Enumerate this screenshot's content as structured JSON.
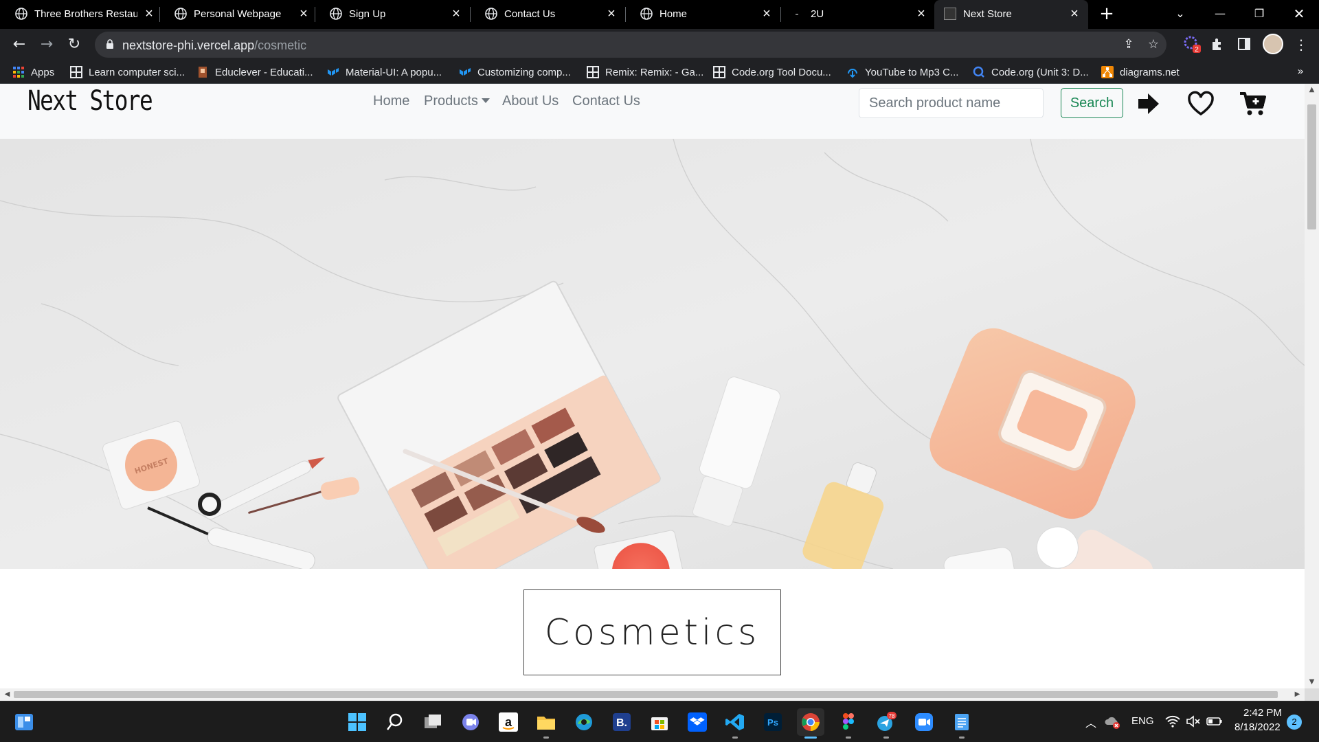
{
  "browser": {
    "tabs": [
      {
        "title": "Three Brothers Restau",
        "active": false
      },
      {
        "title": "Personal Webpage",
        "active": false
      },
      {
        "title": "Sign Up",
        "active": false
      },
      {
        "title": "Contact Us",
        "active": false
      },
      {
        "title": "Home",
        "active": false
      },
      {
        "title": "2U",
        "active": false
      },
      {
        "title": "Next Store",
        "active": true
      }
    ],
    "url_host": "nextstore-phi.vercel.app",
    "url_path": "/cosmetic",
    "extension_badge": "2",
    "bookmarks": [
      {
        "label": "Apps",
        "icon": "apps-grid-icon",
        "color": "#4285f4"
      },
      {
        "label": "Learn computer sci...",
        "icon": "code-org-icon",
        "color": "#e8eaed"
      },
      {
        "label": "Educlever - Educati...",
        "icon": "educlever-icon",
        "color": "#a0522d"
      },
      {
        "label": "Material-UI: A popu...",
        "icon": "mui-icon",
        "color": "#2196f3"
      },
      {
        "label": "Customizing comp...",
        "icon": "mui-icon",
        "color": "#2196f3"
      },
      {
        "label": "Remix: Remix: - Ga...",
        "icon": "code-org-icon",
        "color": "#e8eaed"
      },
      {
        "label": "Code.org Tool Docu...",
        "icon": "code-org-icon",
        "color": "#e8eaed"
      },
      {
        "label": "YouTube to Mp3 C...",
        "icon": "download-icon",
        "color": "#2196f3"
      },
      {
        "label": "Code.org (Unit 3: D...",
        "icon": "q-icon",
        "color": "#4285f4"
      },
      {
        "label": "diagrams.net",
        "icon": "drawio-icon",
        "color": "#f08705"
      }
    ]
  },
  "site": {
    "brand": "Next Store",
    "nav": {
      "home": "Home",
      "products": "Products",
      "about": "About Us",
      "contact": "Contact Us"
    },
    "search_placeholder": "Search product name",
    "search_button": "Search",
    "page_heading": "Cosmetics",
    "hero_labels": {
      "brand_mark": "HONEST"
    }
  },
  "taskbar": {
    "apps": [
      {
        "name": "search",
        "active": false,
        "running": false
      },
      {
        "name": "task-view",
        "active": false,
        "running": false
      },
      {
        "name": "teams",
        "active": false,
        "running": false
      },
      {
        "name": "amazon",
        "active": false,
        "running": false
      },
      {
        "name": "file-explorer",
        "active": false,
        "running": true
      },
      {
        "name": "edge",
        "active": false,
        "running": false
      },
      {
        "name": "booking",
        "active": false,
        "running": false
      },
      {
        "name": "store",
        "active": false,
        "running": false
      },
      {
        "name": "dropbox",
        "active": false,
        "running": false
      },
      {
        "name": "vscode",
        "active": false,
        "running": true
      },
      {
        "name": "photoshop",
        "active": false,
        "running": false
      },
      {
        "name": "chrome",
        "active": true,
        "running": true
      },
      {
        "name": "figma",
        "active": false,
        "running": true
      },
      {
        "name": "telegram",
        "active": false,
        "running": true
      },
      {
        "name": "zoom",
        "active": false,
        "running": false
      },
      {
        "name": "notepad",
        "active": false,
        "running": true
      }
    ],
    "telegram_badge": "78",
    "language": "ENG",
    "time": "2:42 PM",
    "date": "8/18/2022",
    "notifications": "2"
  },
  "colors": {
    "accent_green": "#198754",
    "nav_text": "#6c757d",
    "chrome_dark": "#202124"
  }
}
